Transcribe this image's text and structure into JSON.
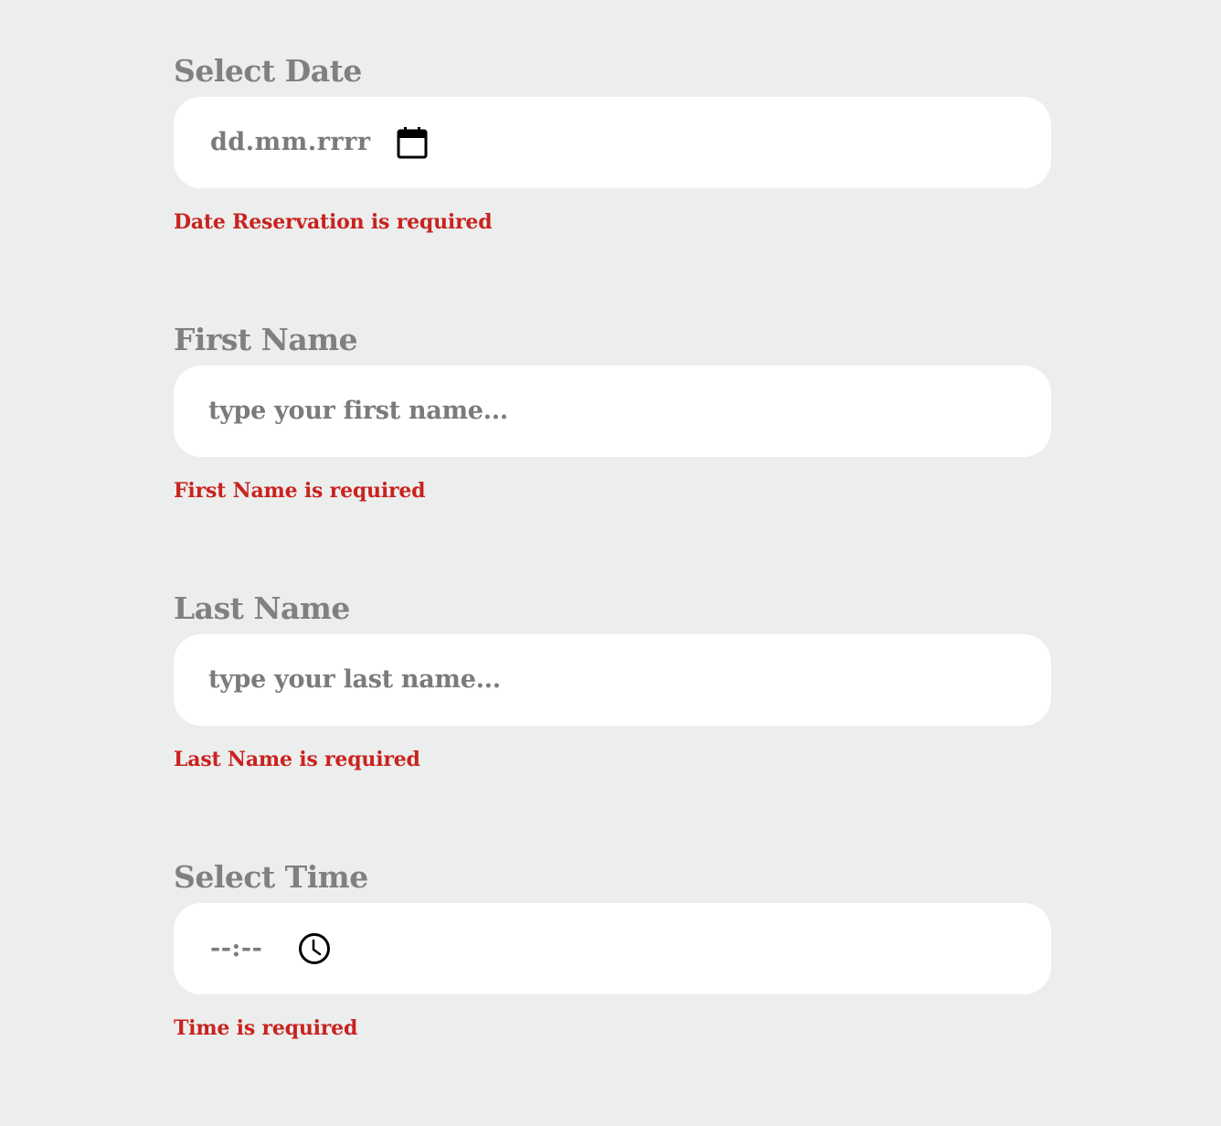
{
  "form": {
    "date": {
      "label": "Select Date",
      "value_format": "dd.mm.rrrr",
      "icon": "calendar-icon",
      "error": "Date Reservation is required"
    },
    "first_name": {
      "label": "First Name",
      "placeholder": "type your first name...",
      "error": "First Name is required"
    },
    "last_name": {
      "label": "Last Name",
      "placeholder": "type your last name...",
      "error": "Last Name is required"
    },
    "time": {
      "label": "Select Time",
      "value_format": "--:--",
      "icon": "clock-icon",
      "error": "Time is required"
    }
  },
  "colors": {
    "background": "#eceeed",
    "label": "#808080",
    "input_background": "#ffffff",
    "placeholder": "#7b7b7b",
    "error": "#c8231f"
  }
}
